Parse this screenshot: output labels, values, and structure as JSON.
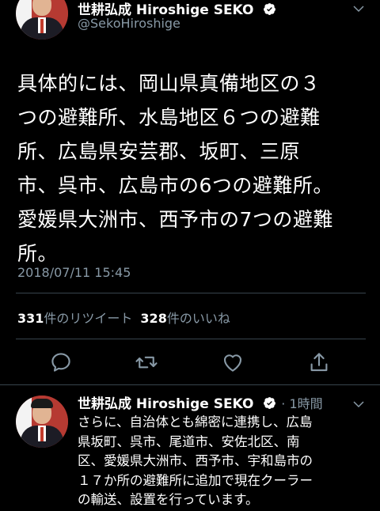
{
  "main_tweet": {
    "author_name": "世耕弘成 Hiroshige SEKO",
    "handle": "@SekoHiroshige",
    "text_lines": [
      "具体的には、岡山県真備地区の３",
      "つの避難所、水島地区６つの避難",
      "所、広島県安芸郡、坂町、三原",
      "市、呉市、広島市の6つの避難所。",
      "愛媛県大洲市、西予市の7つの避難",
      "所。"
    ],
    "timestamp": "2018/07/11 15:45",
    "retweet_count": "331",
    "retweet_label": "件のリツイート",
    "like_count": "328",
    "like_label": "件のいいね"
  },
  "reply_tweet": {
    "author_name": "世耕弘成 Hiroshige SEKO",
    "time": "· 1時間",
    "text_lines": [
      "さらに、自治体とも綿密に連携し、広島",
      "県坂町、呉市、尾道市、安佐北区、南",
      "区、愛媛県大洲市、西予市、宇和島市の",
      "１７か所の避難所に追加で現在クーラー",
      "の輸送、設置を行っています。"
    ]
  },
  "icons": {
    "verified": "verified-badge-icon",
    "reply": "reply-icon",
    "retweet": "retweet-icon",
    "like": "heart-icon",
    "share": "share-icon",
    "more": "chevron-down-icon"
  },
  "colors": {
    "background": "#000000",
    "secondary_text": "#8899a6",
    "divider": "#38444d"
  }
}
